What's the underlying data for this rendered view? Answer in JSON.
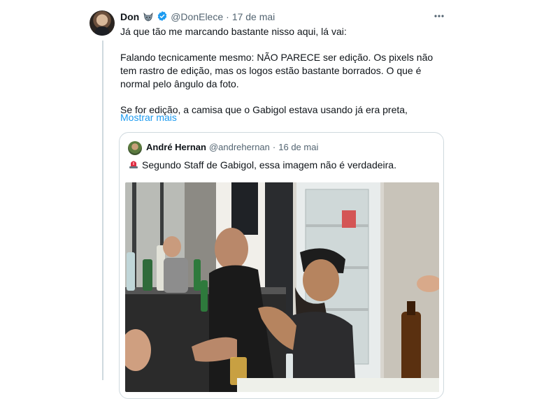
{
  "tweet": {
    "author_name": "Don",
    "author_emoji": "wolf-emoji",
    "verified": true,
    "handle": "@DonElece",
    "separator": "·",
    "date": "17 de mai",
    "paragraphs": [
      "Já que tão me marcando bastante nisso aqui, lá vai:",
      "Falando tecnicamente mesmo: NÃO PARECE ser edição. Os pixels não tem rastro de edição, mas os logos estão bastante borrados. O que é normal pelo ângulo da foto.",
      "Se for edição, a camisa que o Gabigol estava usando já era preta,"
    ],
    "show_more": "Mostrar mais"
  },
  "quoted": {
    "author_name": "André Hernan",
    "handle": "@andrehernan",
    "separator": "·",
    "date": "16 de mai",
    "text": "Segundo Staff de Gabigol, essa imagem não é verdadeira.",
    "emoji": "siren-emoji",
    "photo": "men-seated-at-table-with-bottles"
  },
  "colors": {
    "accent": "#1d9bf0",
    "muted": "#536471",
    "border": "#cfd9de"
  }
}
